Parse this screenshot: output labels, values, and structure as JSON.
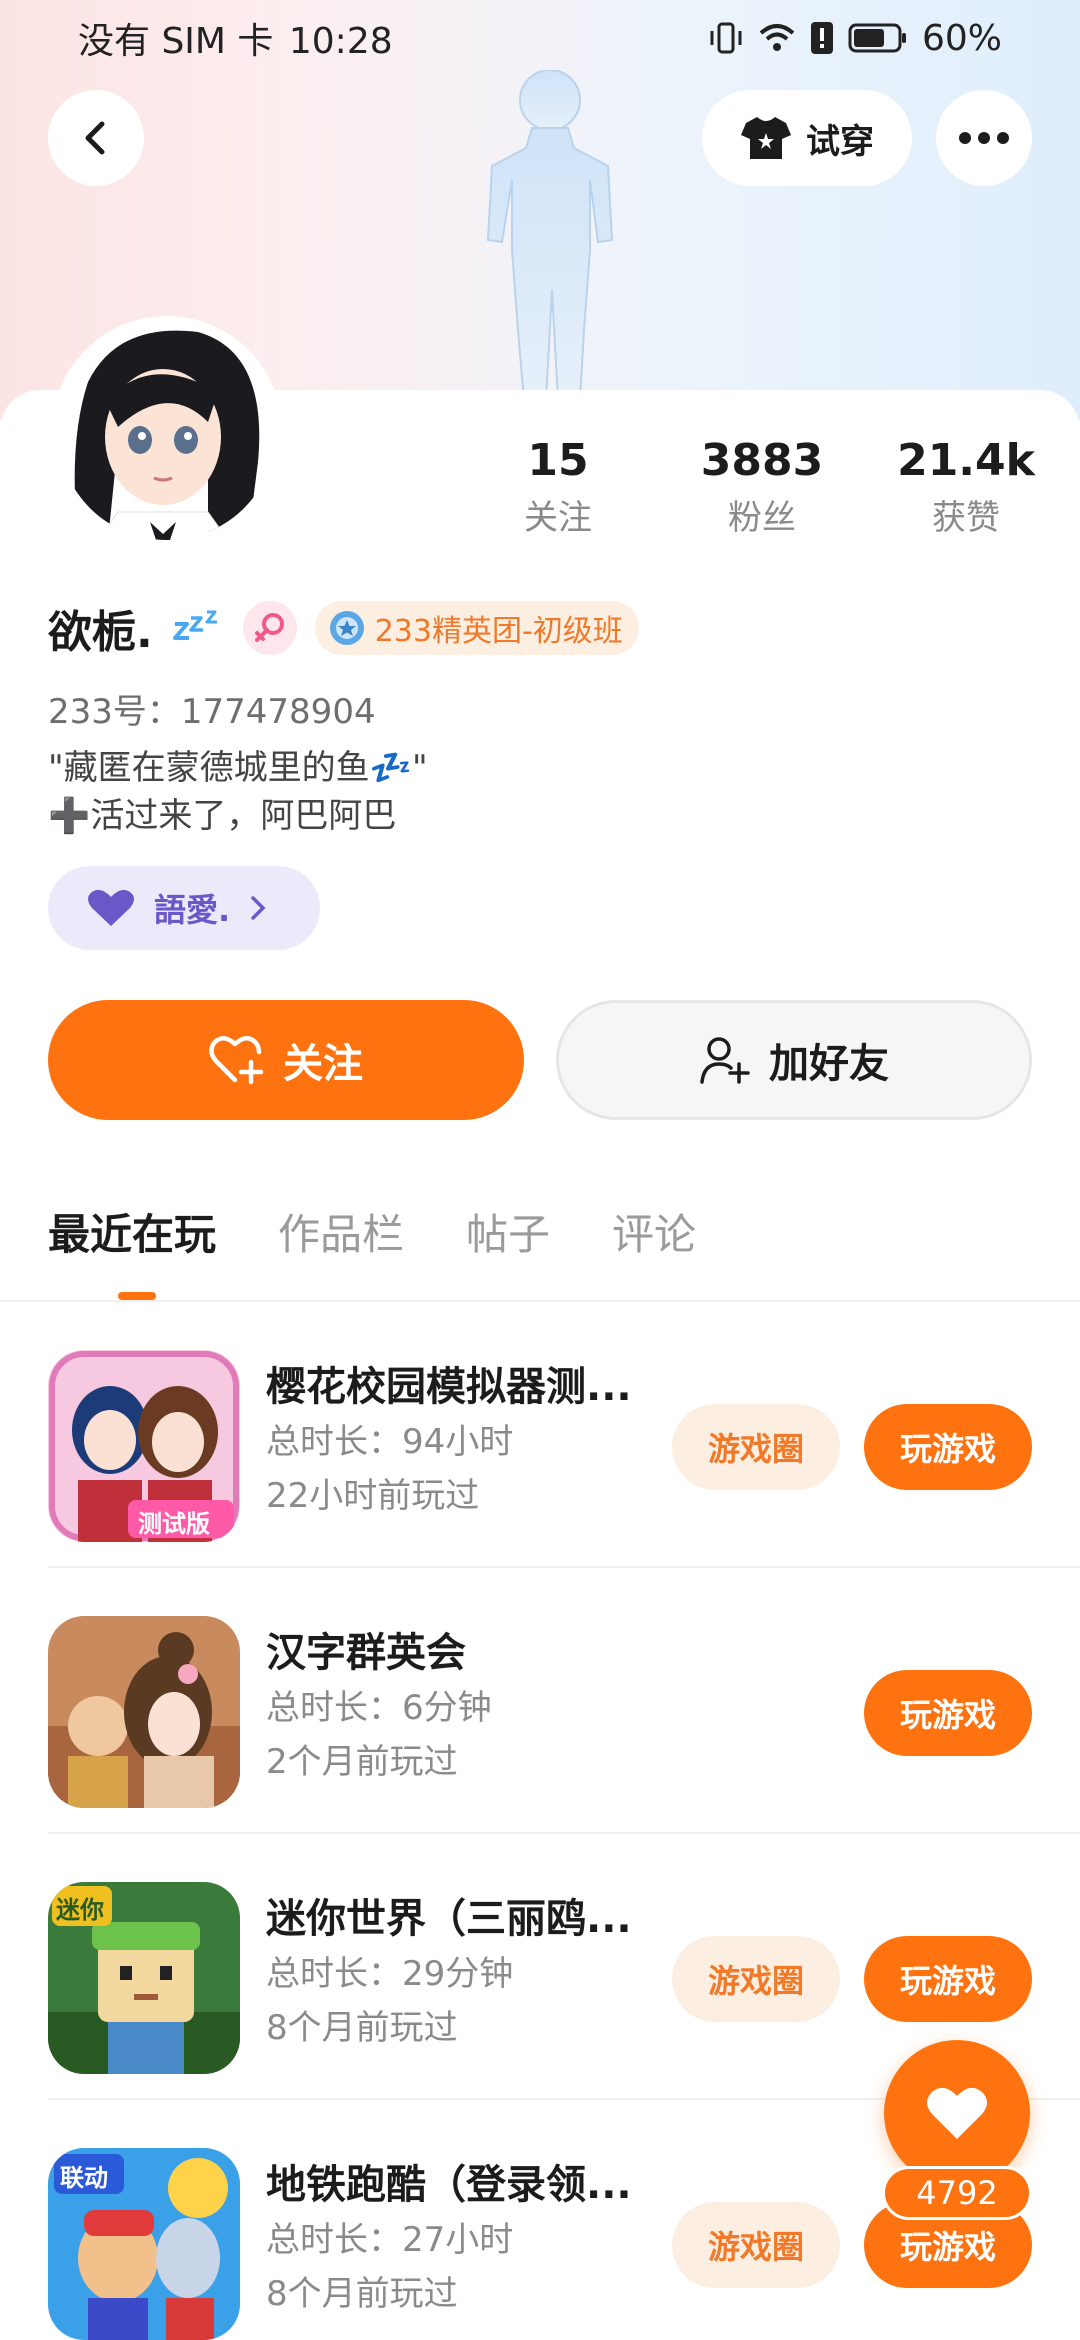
{
  "status_bar": {
    "carrier": "没有 SIM 卡",
    "time": "10:28",
    "battery": "60%"
  },
  "header": {
    "try_on_label": "试穿"
  },
  "stats": [
    {
      "value": "15",
      "label": "关注"
    },
    {
      "value": "3883",
      "label": "粉丝"
    },
    {
      "value": "21.4k",
      "label": "获赞"
    }
  ],
  "profile": {
    "name": "欲栀.",
    "club_badge": "233精英团-初级班",
    "uid": "233号：177478904",
    "bio_line1": "\"藏匿在蒙德城里的鱼💤\"",
    "bio_line2": "➕活过来了，阿巴阿巴",
    "friend_tag": "語愛."
  },
  "actions": {
    "follow": "关注",
    "add_friend": "加好友"
  },
  "tabs": [
    "最近在玩",
    "作品栏",
    "帖子",
    "评论"
  ],
  "games": [
    {
      "title": "樱花校园模拟器测...",
      "duration": "总时长：94小时",
      "last_played": "22小时前玩过",
      "circle": "游戏圈",
      "play": "玩游戏",
      "icon_badge": "测试版"
    },
    {
      "title": "汉字群英会",
      "duration": "总时长：6分钟",
      "last_played": "2个月前玩过",
      "play": "玩游戏"
    },
    {
      "title": "迷你世界（三丽鸥...",
      "duration": "总时长：29分钟",
      "last_played": "8个月前玩过",
      "circle": "游戏圈",
      "play": "玩游戏",
      "icon_badge": "迷你"
    },
    {
      "title": "地铁跑酷（登录领...",
      "duration": "总时长：27小时",
      "last_played": "8个月前玩过",
      "circle": "游戏圈",
      "play": "玩游戏",
      "icon_badge": "联动"
    }
  ],
  "like": {
    "count": "4792"
  },
  "colors": {
    "accent": "#ff7210",
    "accent_soft": "#fdeee2",
    "friend_tag": "#ece9fb"
  }
}
